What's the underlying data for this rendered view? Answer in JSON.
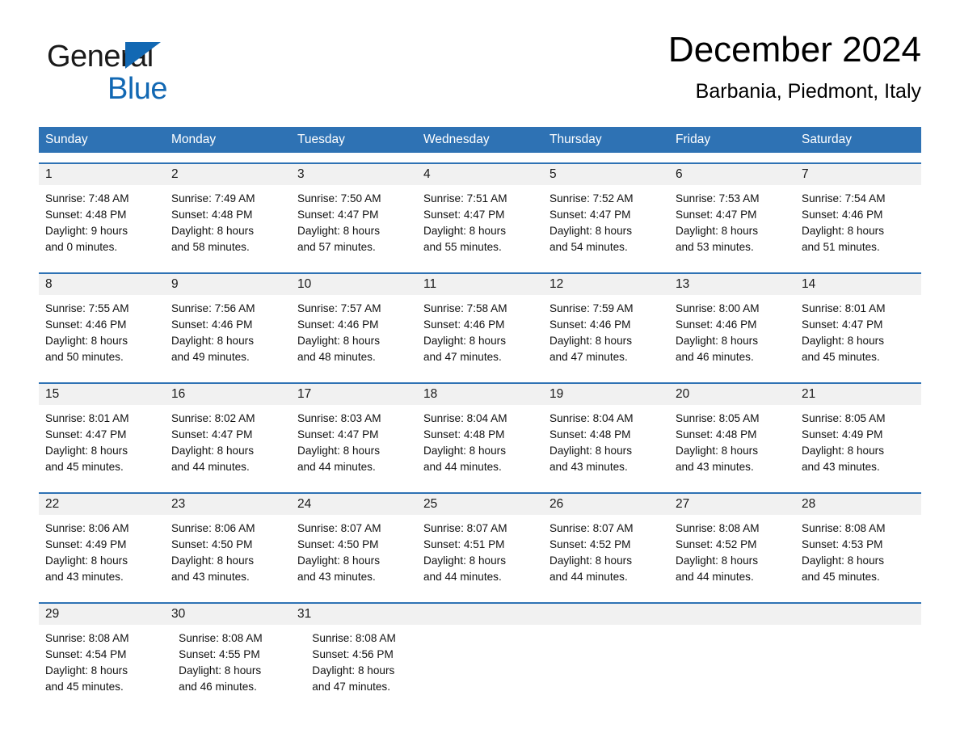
{
  "brand": {
    "name_top": "General",
    "name_bottom": "Blue",
    "triangle_color": "#1268b3",
    "text_color_top": "#1a1a1a",
    "text_color_bottom": "#1268b3"
  },
  "header": {
    "title": "December 2024",
    "subtitle": "Barbania, Piedmont, Italy"
  },
  "theme": {
    "header_blue": "#2e72b4",
    "date_band_gray": "#f1f1f1",
    "text_black": "#111111"
  },
  "weekdays": [
    "Sunday",
    "Monday",
    "Tuesday",
    "Wednesday",
    "Thursday",
    "Friday",
    "Saturday"
  ],
  "weeks": [
    {
      "dates": [
        "1",
        "2",
        "3",
        "4",
        "5",
        "6",
        "7"
      ],
      "cells": [
        {
          "sunrise": "Sunrise: 7:48 AM",
          "sunset": "Sunset: 4:48 PM",
          "daylight1": "Daylight: 9 hours",
          "daylight2": "and 0 minutes."
        },
        {
          "sunrise": "Sunrise: 7:49 AM",
          "sunset": "Sunset: 4:48 PM",
          "daylight1": "Daylight: 8 hours",
          "daylight2": "and 58 minutes."
        },
        {
          "sunrise": "Sunrise: 7:50 AM",
          "sunset": "Sunset: 4:47 PM",
          "daylight1": "Daylight: 8 hours",
          "daylight2": "and 57 minutes."
        },
        {
          "sunrise": "Sunrise: 7:51 AM",
          "sunset": "Sunset: 4:47 PM",
          "daylight1": "Daylight: 8 hours",
          "daylight2": "and 55 minutes."
        },
        {
          "sunrise": "Sunrise: 7:52 AM",
          "sunset": "Sunset: 4:47 PM",
          "daylight1": "Daylight: 8 hours",
          "daylight2": "and 54 minutes."
        },
        {
          "sunrise": "Sunrise: 7:53 AM",
          "sunset": "Sunset: 4:47 PM",
          "daylight1": "Daylight: 8 hours",
          "daylight2": "and 53 minutes."
        },
        {
          "sunrise": "Sunrise: 7:54 AM",
          "sunset": "Sunset: 4:46 PM",
          "daylight1": "Daylight: 8 hours",
          "daylight2": "and 51 minutes."
        }
      ]
    },
    {
      "dates": [
        "8",
        "9",
        "10",
        "11",
        "12",
        "13",
        "14"
      ],
      "cells": [
        {
          "sunrise": "Sunrise: 7:55 AM",
          "sunset": "Sunset: 4:46 PM",
          "daylight1": "Daylight: 8 hours",
          "daylight2": "and 50 minutes."
        },
        {
          "sunrise": "Sunrise: 7:56 AM",
          "sunset": "Sunset: 4:46 PM",
          "daylight1": "Daylight: 8 hours",
          "daylight2": "and 49 minutes."
        },
        {
          "sunrise": "Sunrise: 7:57 AM",
          "sunset": "Sunset: 4:46 PM",
          "daylight1": "Daylight: 8 hours",
          "daylight2": "and 48 minutes."
        },
        {
          "sunrise": "Sunrise: 7:58 AM",
          "sunset": "Sunset: 4:46 PM",
          "daylight1": "Daylight: 8 hours",
          "daylight2": "and 47 minutes."
        },
        {
          "sunrise": "Sunrise: 7:59 AM",
          "sunset": "Sunset: 4:46 PM",
          "daylight1": "Daylight: 8 hours",
          "daylight2": "and 47 minutes."
        },
        {
          "sunrise": "Sunrise: 8:00 AM",
          "sunset": "Sunset: 4:46 PM",
          "daylight1": "Daylight: 8 hours",
          "daylight2": "and 46 minutes."
        },
        {
          "sunrise": "Sunrise: 8:01 AM",
          "sunset": "Sunset: 4:47 PM",
          "daylight1": "Daylight: 8 hours",
          "daylight2": "and 45 minutes."
        }
      ]
    },
    {
      "dates": [
        "15",
        "16",
        "17",
        "18",
        "19",
        "20",
        "21"
      ],
      "cells": [
        {
          "sunrise": "Sunrise: 8:01 AM",
          "sunset": "Sunset: 4:47 PM",
          "daylight1": "Daylight: 8 hours",
          "daylight2": "and 45 minutes."
        },
        {
          "sunrise": "Sunrise: 8:02 AM",
          "sunset": "Sunset: 4:47 PM",
          "daylight1": "Daylight: 8 hours",
          "daylight2": "and 44 minutes."
        },
        {
          "sunrise": "Sunrise: 8:03 AM",
          "sunset": "Sunset: 4:47 PM",
          "daylight1": "Daylight: 8 hours",
          "daylight2": "and 44 minutes."
        },
        {
          "sunrise": "Sunrise: 8:04 AM",
          "sunset": "Sunset: 4:48 PM",
          "daylight1": "Daylight: 8 hours",
          "daylight2": "and 44 minutes."
        },
        {
          "sunrise": "Sunrise: 8:04 AM",
          "sunset": "Sunset: 4:48 PM",
          "daylight1": "Daylight: 8 hours",
          "daylight2": "and 43 minutes."
        },
        {
          "sunrise": "Sunrise: 8:05 AM",
          "sunset": "Sunset: 4:48 PM",
          "daylight1": "Daylight: 8 hours",
          "daylight2": "and 43 minutes."
        },
        {
          "sunrise": "Sunrise: 8:05 AM",
          "sunset": "Sunset: 4:49 PM",
          "daylight1": "Daylight: 8 hours",
          "daylight2": "and 43 minutes."
        }
      ]
    },
    {
      "dates": [
        "22",
        "23",
        "24",
        "25",
        "26",
        "27",
        "28"
      ],
      "cells": [
        {
          "sunrise": "Sunrise: 8:06 AM",
          "sunset": "Sunset: 4:49 PM",
          "daylight1": "Daylight: 8 hours",
          "daylight2": "and 43 minutes."
        },
        {
          "sunrise": "Sunrise: 8:06 AM",
          "sunset": "Sunset: 4:50 PM",
          "daylight1": "Daylight: 8 hours",
          "daylight2": "and 43 minutes."
        },
        {
          "sunrise": "Sunrise: 8:07 AM",
          "sunset": "Sunset: 4:50 PM",
          "daylight1": "Daylight: 8 hours",
          "daylight2": "and 43 minutes."
        },
        {
          "sunrise": "Sunrise: 8:07 AM",
          "sunset": "Sunset: 4:51 PM",
          "daylight1": "Daylight: 8 hours",
          "daylight2": "and 44 minutes."
        },
        {
          "sunrise": "Sunrise: 8:07 AM",
          "sunset": "Sunset: 4:52 PM",
          "daylight1": "Daylight: 8 hours",
          "daylight2": "and 44 minutes."
        },
        {
          "sunrise": "Sunrise: 8:08 AM",
          "sunset": "Sunset: 4:52 PM",
          "daylight1": "Daylight: 8 hours",
          "daylight2": "and 44 minutes."
        },
        {
          "sunrise": "Sunrise: 8:08 AM",
          "sunset": "Sunset: 4:53 PM",
          "daylight1": "Daylight: 8 hours",
          "daylight2": "and 45 minutes."
        }
      ]
    },
    {
      "dates": [
        "29",
        "30",
        "31",
        "",
        "",
        "",
        ""
      ],
      "cells": [
        {
          "sunrise": "Sunrise: 8:08 AM",
          "sunset": "Sunset: 4:54 PM",
          "daylight1": "Daylight: 8 hours",
          "daylight2": "and 45 minutes."
        },
        {
          "sunrise": "Sunrise: 8:08 AM",
          "sunset": "Sunset: 4:55 PM",
          "daylight1": "Daylight: 8 hours",
          "daylight2": "and 46 minutes."
        },
        {
          "sunrise": "Sunrise: 8:08 AM",
          "sunset": "Sunset: 4:56 PM",
          "daylight1": "Daylight: 8 hours",
          "daylight2": "and 47 minutes."
        },
        {
          "sunrise": "",
          "sunset": "",
          "daylight1": "",
          "daylight2": ""
        },
        {
          "sunrise": "",
          "sunset": "",
          "daylight1": "",
          "daylight2": ""
        },
        {
          "sunrise": "",
          "sunset": "",
          "daylight1": "",
          "daylight2": ""
        },
        {
          "sunrise": "",
          "sunset": "",
          "daylight1": "",
          "daylight2": ""
        }
      ]
    }
  ]
}
